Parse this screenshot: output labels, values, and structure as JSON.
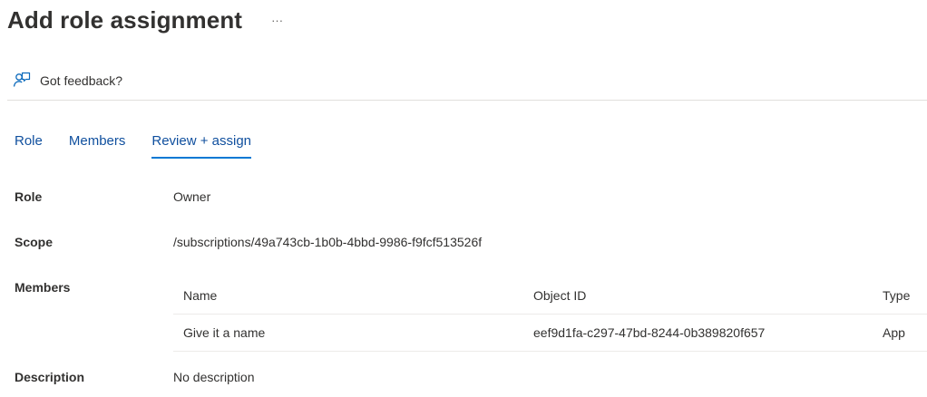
{
  "header": {
    "title": "Add role assignment",
    "more_label": "···"
  },
  "toolbar": {
    "feedback_label": "Got feedback?",
    "feedback_icon": "feedback-icon"
  },
  "tabs": [
    {
      "label": "Role",
      "active": false
    },
    {
      "label": "Members",
      "active": false
    },
    {
      "label": "Review + assign",
      "active": true
    }
  ],
  "review": {
    "role": {
      "label": "Role",
      "value": "Owner"
    },
    "scope": {
      "label": "Scope",
      "value": "/subscriptions/49a743cb-1b0b-4bbd-9986-f9fcf513526f"
    },
    "members": {
      "label": "Members",
      "columns": [
        "Name",
        "Object ID",
        "Type"
      ],
      "rows": [
        {
          "name": "Give it a name",
          "object_id": "eef9d1fa-c297-47bd-8244-0b389820f657",
          "type": "App"
        }
      ]
    },
    "description": {
      "label": "Description",
      "value": "No description"
    }
  },
  "colors": {
    "accent": "#0078d4",
    "link": "#0f4f9e",
    "text": "#323130",
    "divider": "#e1dfdd"
  }
}
